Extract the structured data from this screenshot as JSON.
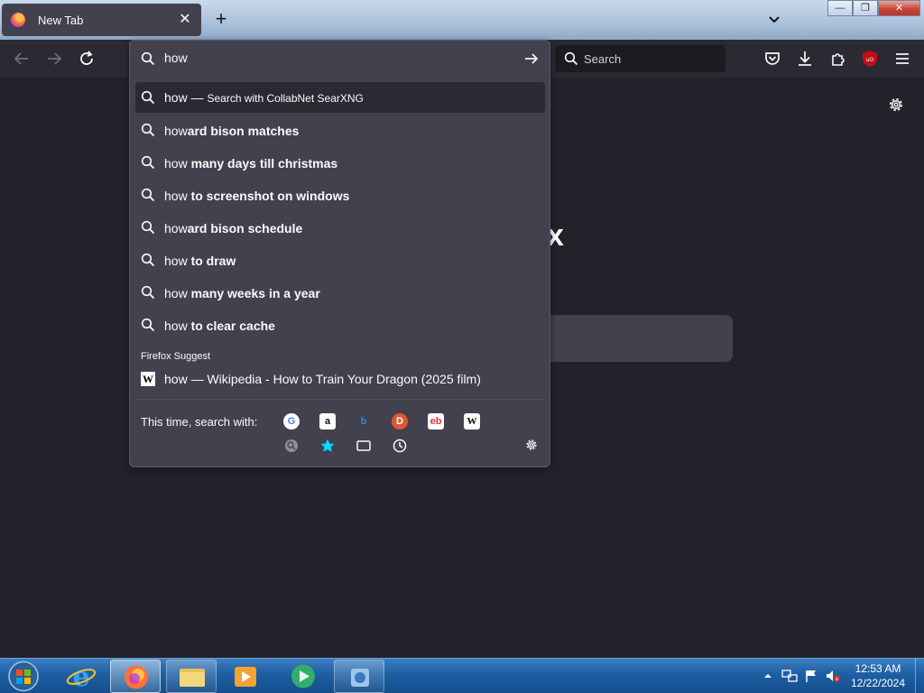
{
  "tab": {
    "title": "New Tab",
    "close": "✕"
  },
  "newtab_label": "+",
  "window_controls": {
    "minimize": "—",
    "maximize": "❐",
    "close": "✕"
  },
  "navbar": {
    "search_placeholder": "Search"
  },
  "urlbar": {
    "query": "how",
    "results": [
      {
        "typed": "how",
        "suffix": "",
        "separator": " — ",
        "action": "Search with CollabNet SearXNG",
        "selected": true
      },
      {
        "typed": "how",
        "suffix": "ard bison matches"
      },
      {
        "typed": "how",
        "suffix": " many days till christmas"
      },
      {
        "typed": "how",
        "suffix": " to screenshot on windows"
      },
      {
        "typed": "how",
        "suffix": "ard bison schedule"
      },
      {
        "typed": "how",
        "suffix": " to draw"
      },
      {
        "typed": "how",
        "suffix": " many weeks in a year"
      },
      {
        "typed": "how",
        "suffix": " to clear cache"
      }
    ],
    "suggest_label": "Firefox Suggest",
    "wiki_result": {
      "icon": "W",
      "text": "how — Wikipedia - How to Train Your Dragon (2025 film)"
    },
    "oneoff_label": "This time, search with:",
    "oneoff_engines": [
      {
        "name": "google-icon",
        "glyph": "G",
        "color": "#4285f4"
      },
      {
        "name": "amazon-icon",
        "glyph": "a",
        "color": "#ffffff"
      },
      {
        "name": "bing-icon",
        "glyph": "b",
        "color": "#2b8fe0"
      },
      {
        "name": "duckduckgo-icon",
        "glyph": "D",
        "color": "#de5833"
      },
      {
        "name": "ebay-icon",
        "glyph": "eb",
        "color": "#e53238"
      },
      {
        "name": "wikipedia-icon",
        "glyph": "W",
        "color": "#ffffff"
      }
    ],
    "oneoff_modes": [
      {
        "name": "searxng-icon"
      },
      {
        "name": "bookmarks-icon"
      },
      {
        "name": "tabs-icon"
      },
      {
        "name": "history-icon"
      }
    ]
  },
  "content": {
    "logo_fragment": "x"
  },
  "taskbar": {
    "time": "12:53 AM",
    "date": "12/22/2024"
  },
  "colors": {
    "firefox_bg": "#1c1b22",
    "popup_bg": "#42414d",
    "accent_star": "#00ddff",
    "taskbar": "#1d5fa3"
  }
}
